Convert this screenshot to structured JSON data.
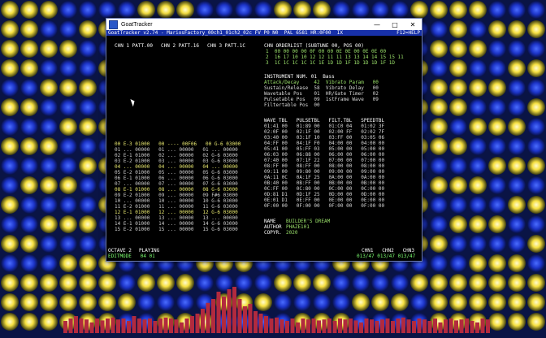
{
  "window": {
    "title": "GoatTracker",
    "minimize": "—",
    "maximize": "□",
    "close": "✕"
  },
  "header": {
    "left": "GoatTracker v2.74 - MariosFactory_00ch1_01ch2_02c FV P0 N0  PAL 6581 HR:0F00  IX",
    "right": "F12=HELP"
  },
  "channels": {
    "chn1": "CHN 1 PATT.00",
    "chn2": "CHN 2 PATT.16",
    "chn3": "CHN 3 PATT.1C"
  },
  "orderlist": {
    "title": "CHN ORDERLIST (SUBTUNE 00, POS 00)",
    "rows": [
      "1  00 00 00 00 0F 00 00 0E 0E 00 0E 0E 00",
      "2  16 17 10 10 12 12 11 11 13 13 14 14 15 15 11",
      "3  1C 1C 1C 1C 1C 1E 1D 1D 1F 1D 1D 1D 1F 1D"
    ]
  },
  "instrument": {
    "title": "INSTRUMENT NUM. 01  Bass",
    "rows": [
      "Attack/Decay     42  Vibrato Param   00",
      "Sustain/Release  58  Vibrato Delay   00",
      "Wavetable Pos    01  HR/Gate Timer   02",
      "Pulsetable Pos   09  1stFrame Wave   09",
      "Filtertable Pos  00"
    ]
  },
  "tables": {
    "title": "WAVE TBL   PULSETBL   FILT.TBL   SPEEDTBL",
    "rows": [
      "01:41 00   01:89 00   01:C0 04   01:02 3F",
      "02:0F 00   02:1F 00   02:00 FF   02:02 7F",
      "03:40 00   03:1F 10   03:FF 00   03:05 06",
      "04:FF 00   04:1F F0   04:00 00   04:00 00",
      "05:41 00   05:FF 03   05:00 00   05:00 00",
      "06:03 00   06:88 00   06:00 00   06:00 00",
      "07:40 00   07:1F 22   07:00 00   07:00 00",
      "08:FF 00   08:FF 00   08:00 00   08:00 00",
      "09:11 00   09:80 00   09:00 00   09:00 00",
      "0A:11 0C   0A:1F 25   0A:00 00   0A:00 00",
      "0B:40 00   0B:FF 00   0B:00 00   0B:00 00",
      "0C:FF 00   0C:80 00   0C:00 00   0C:00 00",
      "0D:81 D1   0D:1F 25   0D:00 00   0D:00 00",
      "0E:01 D1   0E:FF 00   0E:00 00   0E:00 00",
      "0F:00 00   0F:00 00   0F:00 00   0F:00 00"
    ]
  },
  "pattern": {
    "rows": [
      "00 E-3 01000   00 ---- 00F06   00 G-6 03000",
      "01 ... 00000   01 ... 00000   01 ... 00000",
      "02 E-1 01000   02 ... 00000   02 G-6 03000",
      "03 E-2 01000   03 ... 00000   03 G-6 03000",
      "04 ... 00000   04 ... 00000   04 ... 00000",
      "05 E-2 01000   05 ... 00000   05 G-6 03000",
      "06 E-1 01000   06 ... 00000   06 G-6 03000",
      "07 ... 00000   07 ... 00000   07 G-6 03000",
      "08 E-1 01000   08 ... 00000   08 G-6 03000",
      "09 E-2 01000   09 ... 00000   09 F#6 03000",
      "10 ... 00000   10 ... 00000   10 G-6 03000",
      "11 E-2 01000   11 ... 00000   11 G-6 03000",
      "12 E-1 01000   12 ... 00000   12 G-6 03000",
      "13 ... 00000   13 ... 00000   13 ... 00000",
      "14 E-1 01000   14 ... 00000   14 G-6 03000",
      "15 E-2 01000   15 ... 00000   15 G-6 03000"
    ]
  },
  "song": {
    "name_label": "NAME",
    "name": "BUILDER'S DREAM",
    "author_label": "AUTHOR",
    "author": "PHAZE101",
    "copyr_label": "COPYR.",
    "copyr": "2020"
  },
  "status": {
    "octave": "OCTAVE 2",
    "mode": "PLAYING",
    "editmode": "EDITMODE   04 01",
    "chn_labels": "CHN1   CHN2   CHN3",
    "chn_values": "013/47 013/47 013/47"
  },
  "colors": {
    "header_bar": "#1730a8",
    "highlight": "#9ae06a",
    "order_red": "#ff5040",
    "background": "#0a1a55"
  },
  "visualizer": {
    "levels": [
      0.25,
      0.3,
      0.35,
      0.3,
      0.28,
      0.22,
      0.3,
      0.26,
      0.3,
      0.32,
      0.28,
      0.3,
      0.25,
      0.35,
      0.3,
      0.28,
      0.3,
      0.25,
      0.3,
      0.32,
      0.3,
      0.28,
      0.22,
      0.3,
      0.35,
      0.4,
      0.5,
      0.62,
      0.7,
      0.85,
      0.75,
      0.9,
      0.95,
      0.7,
      0.55,
      0.6,
      0.45,
      0.4,
      0.35,
      0.3,
      0.32,
      0.28,
      0.25,
      0.3,
      0.22,
      0.3,
      0.28,
      0.3,
      0.26,
      0.28,
      0.3,
      0.25,
      0.3,
      0.28,
      0.3,
      0.26,
      0.22,
      0.3,
      0.28,
      0.25,
      0.28,
      0.3,
      0.25,
      0.3,
      0.32,
      0.28,
      0.25,
      0.3,
      0.28,
      0.25,
      0.3,
      0.22,
      0.28,
      0.3,
      0.26,
      0.28,
      0.3,
      0.25,
      0.22,
      0.3,
      0.28
    ]
  }
}
